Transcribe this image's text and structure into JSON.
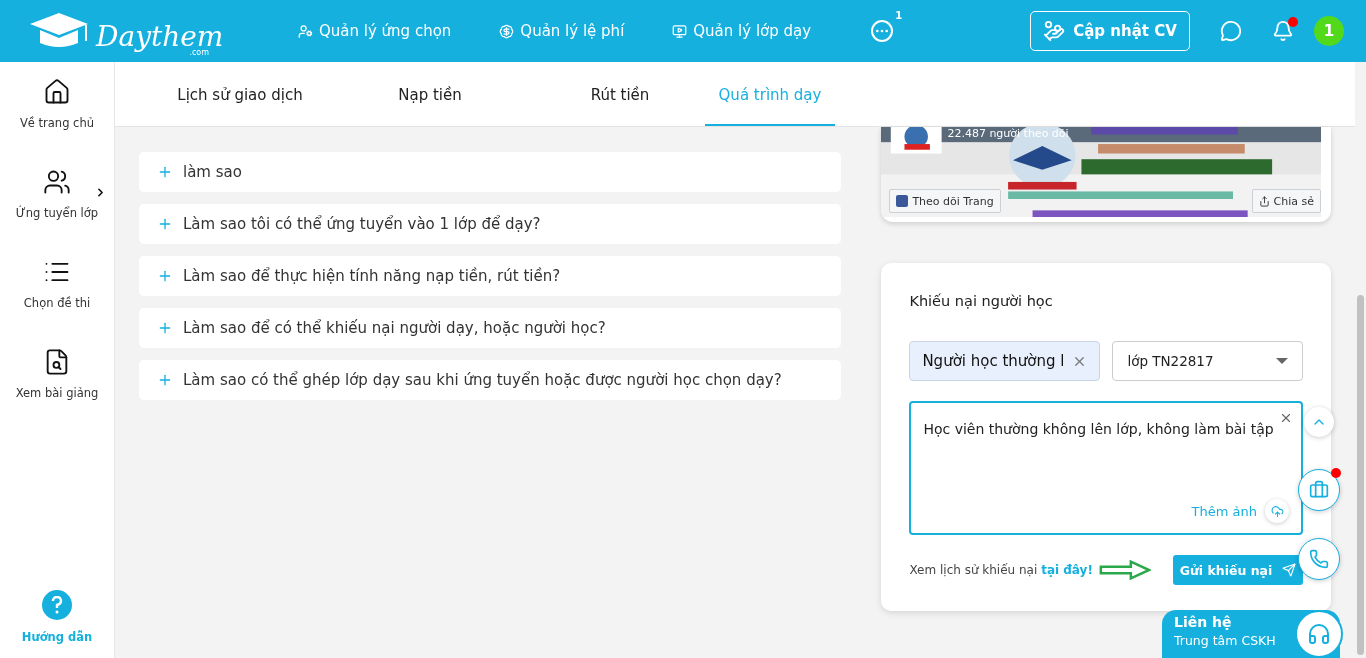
{
  "logo": {
    "name": "Daythem",
    "suffix": ".com"
  },
  "nav": [
    {
      "label": "Quản lý ứng chọn"
    },
    {
      "label": "Quản lý lệ phí"
    },
    {
      "label": "Quản lý lớp dạy"
    }
  ],
  "more_badge": "1",
  "update_cv": "Cập nhật CV",
  "notification_dot": true,
  "avatar": "1",
  "sidebar": [
    {
      "label": "Về trang chủ",
      "expandable": false
    },
    {
      "label": "Ứng tuyển lớp",
      "expandable": true
    },
    {
      "label": "Chọn đề thi",
      "expandable": false
    },
    {
      "label": "Xem bài giảng",
      "expandable": false
    }
  ],
  "help": "Hướng dẫn",
  "tabs": [
    {
      "label": "Lịch sử giao dịch",
      "selected": false
    },
    {
      "label": "Nạp tiền",
      "selected": false
    },
    {
      "label": "Rút tiền",
      "selected": false
    },
    {
      "label": "Quá trình dạy",
      "selected": true
    }
  ],
  "faq": [
    {
      "question": "làm sao",
      "expanded": false
    },
    {
      "question": "Làm sao tôi có thể ứng tuyển vào 1 lớp để dạy?",
      "expanded": false
    },
    {
      "question": "Làm sao để thực hiện tính năng nạp tiền, rút tiền?",
      "expanded": false
    },
    {
      "question": "Làm sao để có thể khiếu nại người dạy, hoặc người học?",
      "expanded": false
    },
    {
      "question": "Làm sao có thể ghép lớp dạy sau khi ứng tuyển hoặc được người học chọn dạy?",
      "expanded": false
    }
  ],
  "fanpage": {
    "followers": "22.487 người theo dõi",
    "follow": "Theo dõi Trang",
    "share": "Chia sẻ"
  },
  "complaint": {
    "title": "Khiếu nại người học",
    "tag": "Người học thường l",
    "class_select": "lớp TN22817",
    "message": "Học viên thường không lên lớp, không làm bài tập",
    "add_photo": "Thêm ảnh",
    "history_text": "Xem lịch sử khiếu nại",
    "history_link": "tại đây!",
    "submit": "Gửi khiếu nại"
  },
  "contact": {
    "title": "Liên hệ",
    "subtitle": "Trung tâm CSKH"
  },
  "briefcase_dot": true
}
